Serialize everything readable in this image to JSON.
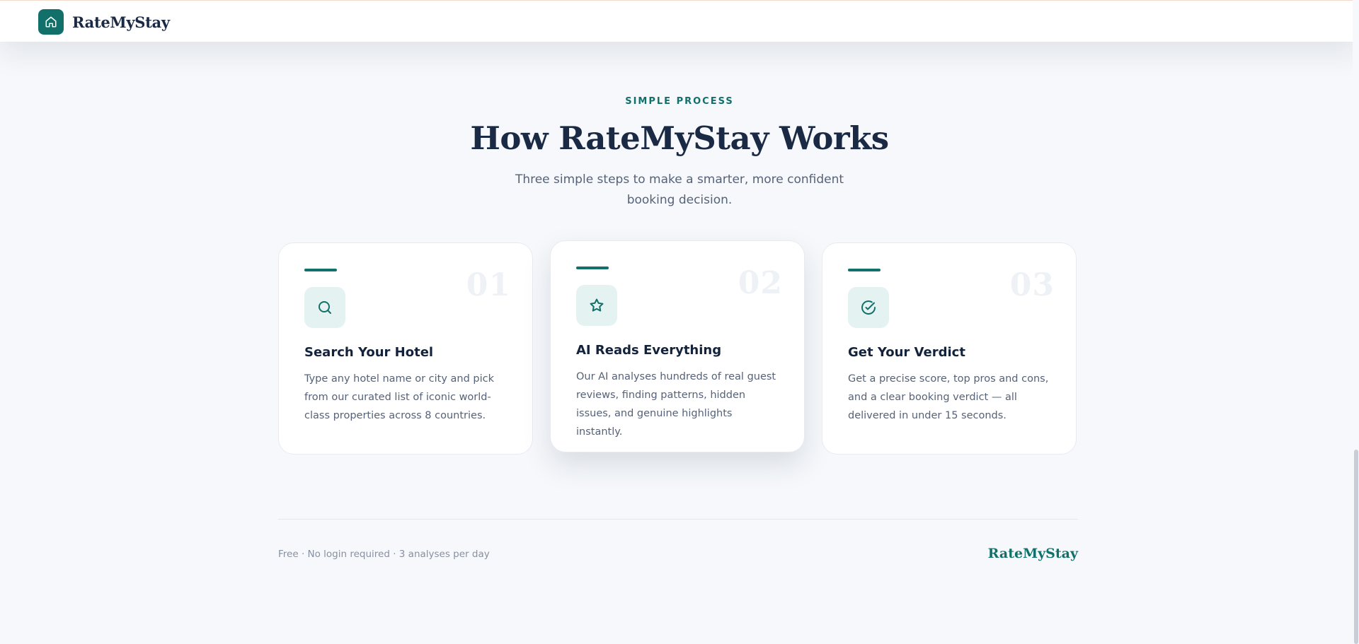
{
  "nav": {
    "brand": "RateMyStay",
    "logo_icon": "home-icon"
  },
  "section": {
    "eyebrow": "SIMPLE PROCESS",
    "title": "How RateMyStay Works",
    "subtitle": "Three simple steps to make a smarter, more confident booking decision."
  },
  "steps": [
    {
      "number": "01",
      "icon": "search-icon",
      "title": "Search Your Hotel",
      "description": "Type any hotel name or city and pick from our curated list of iconic world-class properties across 8 countries."
    },
    {
      "number": "02",
      "icon": "star-icon",
      "title": "AI Reads Everything",
      "description": "Our AI analyses hundreds of real guest reviews, finding patterns, hidden issues, and genuine highlights instantly."
    },
    {
      "number": "03",
      "icon": "check-circle-icon",
      "title": "Get Your Verdict",
      "description": "Get a precise score, top pros and cons, and a clear booking verdict — all delivered in under 15 seconds."
    }
  ],
  "footer": {
    "note": "Free · No login required · 3 analyses per day",
    "brand": "RateMyStay"
  },
  "colors": {
    "accent": "#12706b",
    "heading": "#1b2a44",
    "background": "#f6f8fb",
    "icon_tile": "#e4f3f1"
  }
}
